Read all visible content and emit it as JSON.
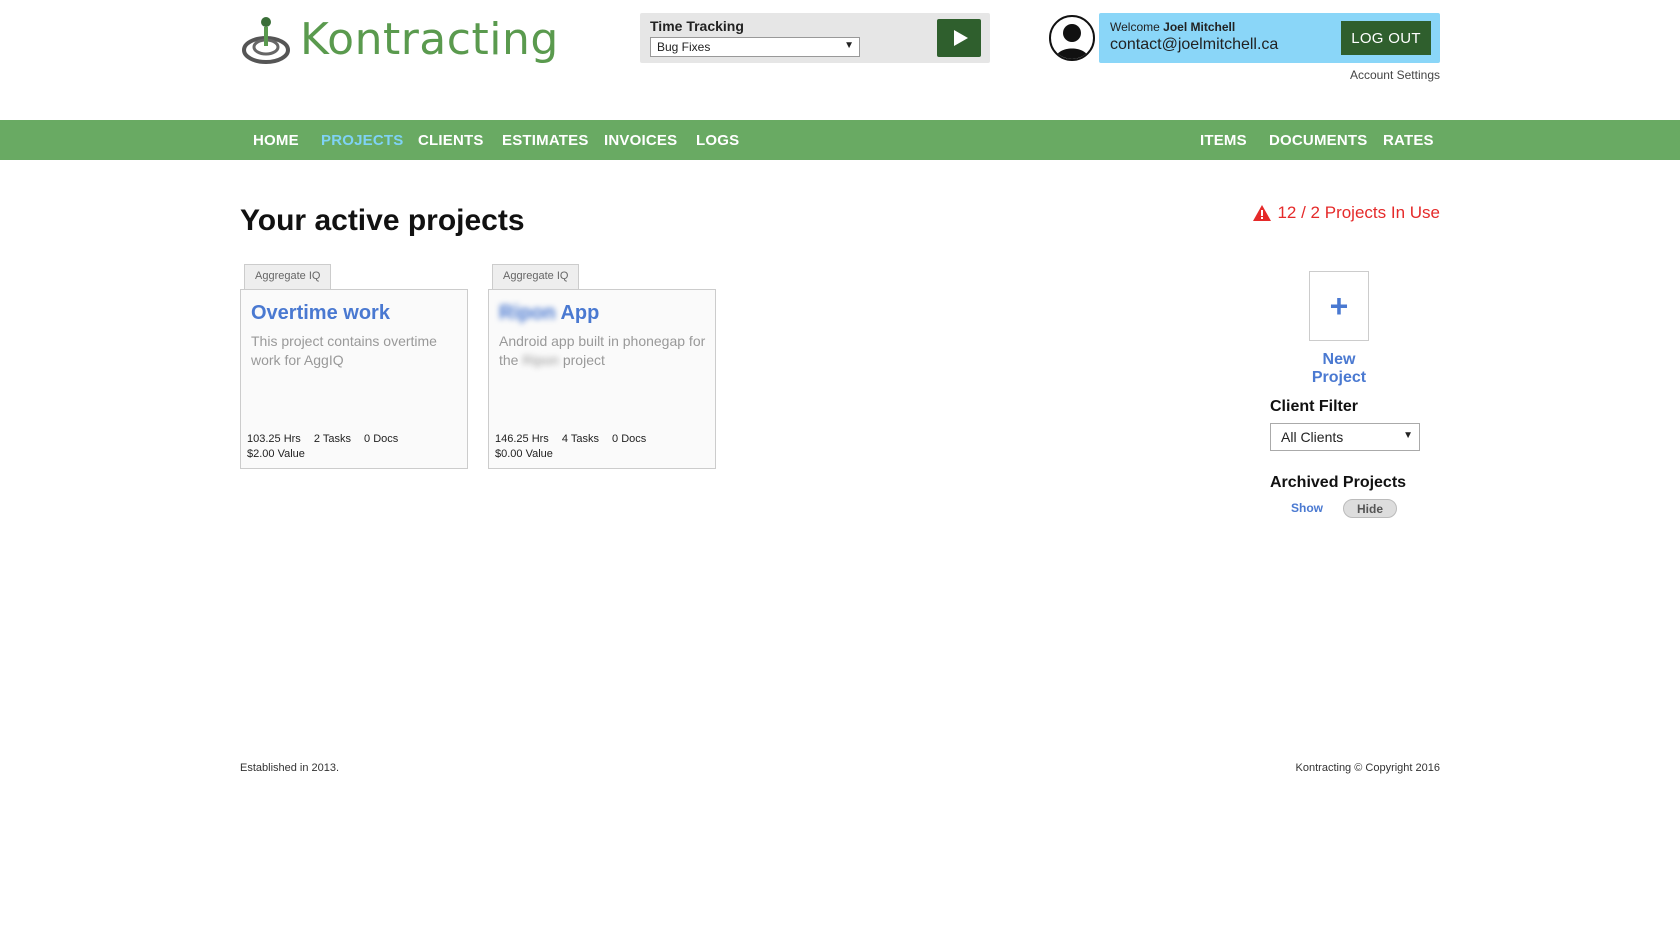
{
  "header": {
    "logo_text": "Kontracting",
    "time_tracking": {
      "label": "Time Tracking",
      "selected_task": "Bug Fixes"
    },
    "user": {
      "welcome_prefix": "Welcome",
      "name": "Joel Mitchell",
      "email": "contact@joelmitchell.ca",
      "logout_label": "LOG OUT",
      "account_settings_label": "Account Settings"
    }
  },
  "nav": {
    "left": [
      "HOME",
      "PROJECTS",
      "CLIENTS",
      "ESTIMATES",
      "INVOICES",
      "LOGS"
    ],
    "right": [
      "ITEMS",
      "DOCUMENTS",
      "RATES"
    ],
    "active": "PROJECTS"
  },
  "main": {
    "title": "Your active projects",
    "usage_warning": "12 / 2 Projects In Use",
    "projects": [
      {
        "client": "Aggregate IQ",
        "title": "Overtime work",
        "description": "This project contains overtime work for AggIQ",
        "hours": "103.25 Hrs",
        "tasks": "2 Tasks",
        "docs": "0 Docs",
        "value": "$2.00 Value"
      },
      {
        "client": "Aggregate IQ",
        "title_blurred": "Ripon",
        "title_rest": "App",
        "description_start": "Android app built in phonegap for the",
        "description_blurred": "Ripon",
        "description_end": "project",
        "hours": "146.25 Hrs",
        "tasks": "4 Tasks",
        "docs": "0 Docs",
        "value": "$0.00 Value"
      }
    ]
  },
  "sidebar": {
    "new_project_label": "New Project",
    "client_filter_label": "Client Filter",
    "client_filter_value": "All Clients",
    "archived_label": "Archived Projects",
    "archived_show": "Show",
    "archived_hide": "Hide"
  },
  "footer": {
    "left": "Established in 2013.",
    "right": "Kontracting © Copyright 2016"
  },
  "colors": {
    "brand_green": "#69aa63",
    "dark_green": "#2f5f2d",
    "link_blue": "#4a79d1",
    "active_nav": "#7fd2f5",
    "user_box": "#8ad6f8",
    "warning_red": "#e52a2a"
  }
}
